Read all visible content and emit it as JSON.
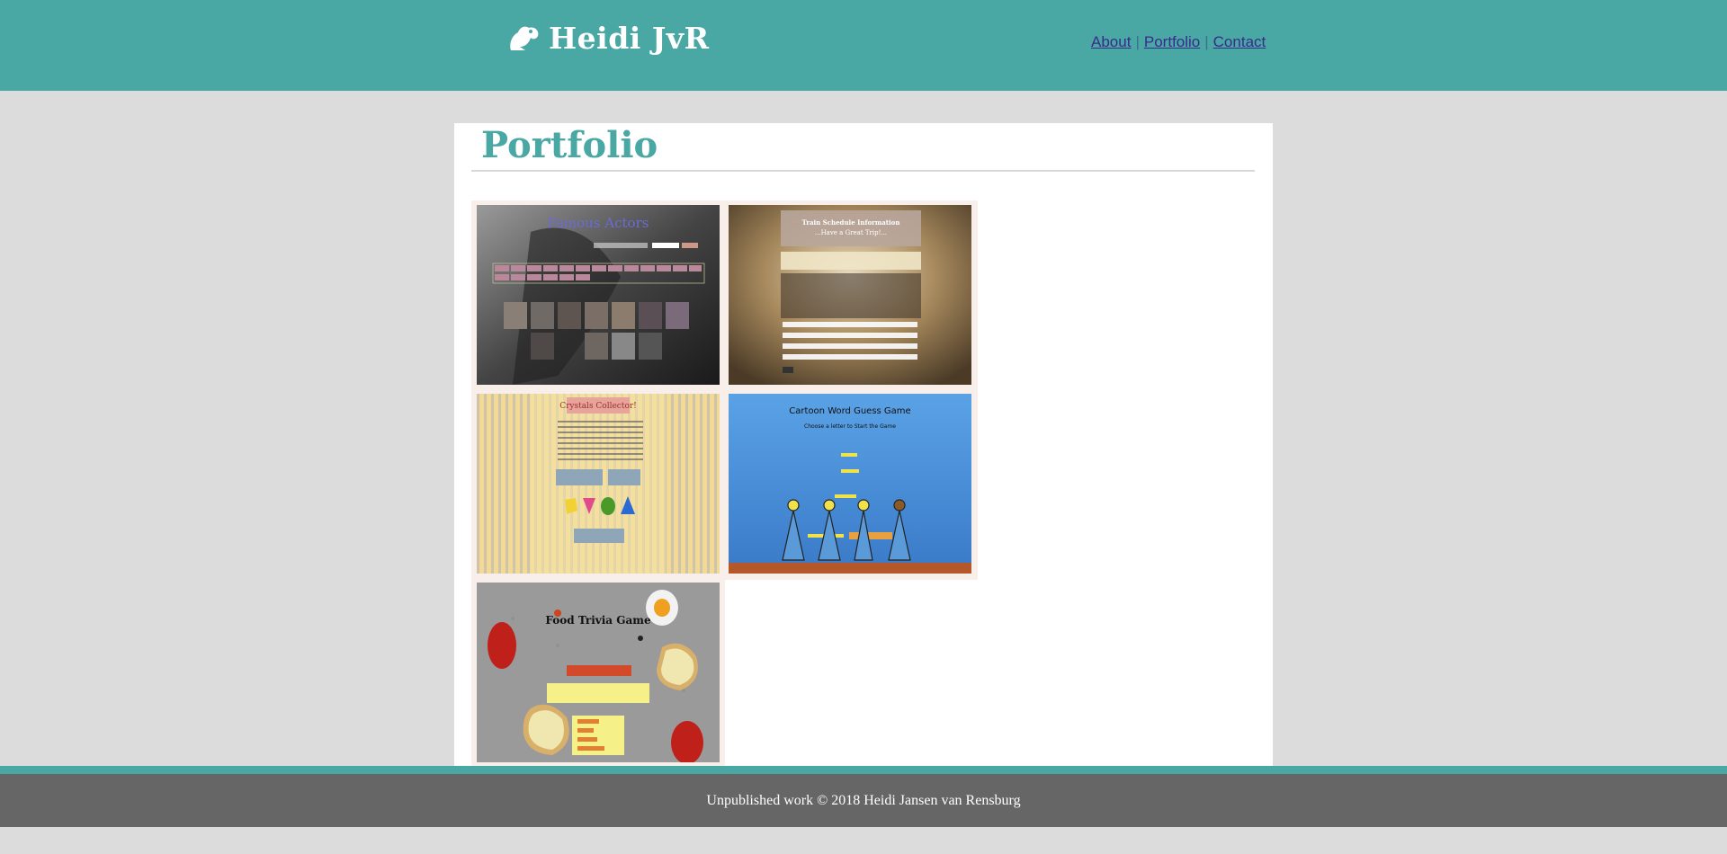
{
  "header": {
    "brand": "Heidi JvR",
    "brand_icon": "frog-icon",
    "nav": [
      {
        "label": "About"
      },
      {
        "label": "Portfolio"
      },
      {
        "label": "Contact"
      }
    ],
    "separator": "|"
  },
  "main": {
    "title": "Portfolio",
    "projects": [
      {
        "caption": "Famous Actors"
      },
      {
        "caption": "Train Schedule Information",
        "subcaption": "...Have a Great Trip!..."
      },
      {
        "caption": "Crystals Collector!"
      },
      {
        "caption": "Cartoon Word Guess Game",
        "subcaption": "Choose a letter to Start the Game"
      },
      {
        "caption": "Food Trivia Game"
      }
    ]
  },
  "footer": {
    "text": "Unpublished work © 2018 Heidi Jansen van Rensburg"
  },
  "colors": {
    "teal": "#4aa8a4",
    "footer_gray": "#666666",
    "page_bg": "#dcdcdc"
  }
}
